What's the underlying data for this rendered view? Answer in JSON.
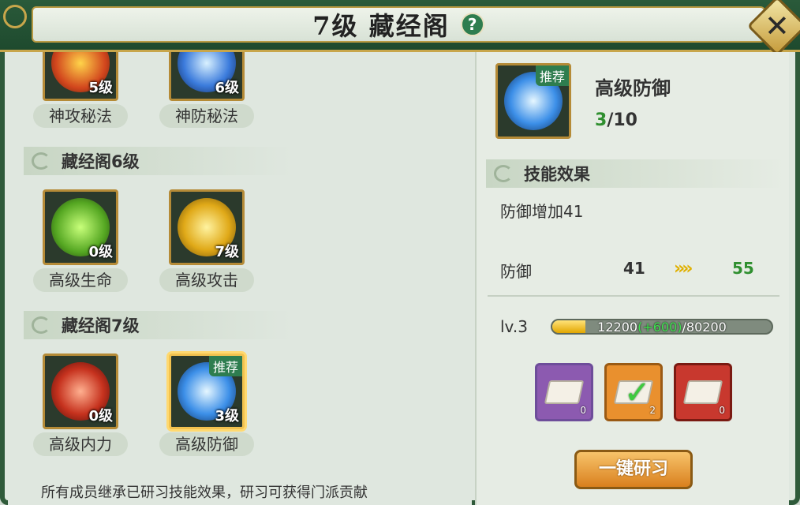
{
  "header": {
    "title": "7级 藏经阁",
    "help_symbol": "?",
    "close_symbol": "✕"
  },
  "left_panel": {
    "row0": [
      {
        "name": "神攻秘法",
        "level": "5级"
      },
      {
        "name": "神防秘法",
        "level": "6级"
      }
    ],
    "section6": "藏经阁6级",
    "row6": [
      {
        "name": "高级生命",
        "level": "0级"
      },
      {
        "name": "高级攻击",
        "level": "7级"
      }
    ],
    "section7": "藏经阁7级",
    "row7": [
      {
        "name": "高级内力",
        "level": "0级"
      },
      {
        "name": "高级防御",
        "level": "3级",
        "tag": "推荐"
      }
    ],
    "footnote": "所有成员继承已研习技能效果，研习可获得门派贡献"
  },
  "detail": {
    "tag": "推荐",
    "name": "高级防御",
    "progress_current": "3",
    "progress_total": "/10",
    "effect_section": "技能效果",
    "effect_text": "防御增加41",
    "stat_name": "防御",
    "stat_from": "41",
    "stat_arrow": "»»",
    "stat_to": "55",
    "level_label": "lv.3",
    "exp_current": "12200",
    "exp_bonus": "(+600)",
    "exp_total": "/80200",
    "exp_fraction": 0.152,
    "items": [
      {
        "count": "0",
        "color": "#8c5ab0"
      },
      {
        "count": "2",
        "color": "#e9902e"
      },
      {
        "count": "0",
        "color": "#c8382e"
      }
    ],
    "study_button": "一键研习"
  }
}
